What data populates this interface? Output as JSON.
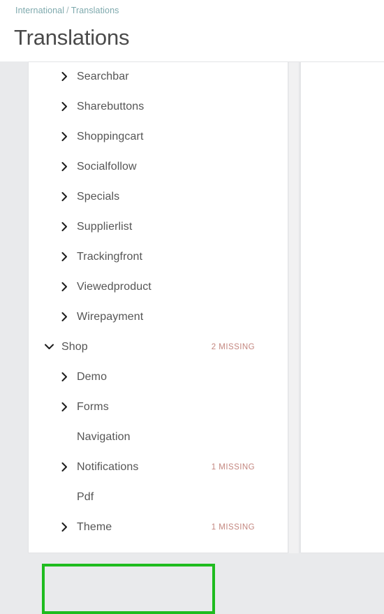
{
  "header": {
    "breadcrumb": {
      "parent": "International",
      "separator": "/",
      "current": "Translations"
    },
    "title": "Translations"
  },
  "colors": {
    "accent_breadcrumb": "#7ea9ad",
    "missing_badge": "#c3867f",
    "highlight_box": "#1fbc1f",
    "row_text": "#555555",
    "page_background": "#e9eaec"
  },
  "tree": {
    "rows": [
      {
        "label": "Searchbar",
        "level": 1,
        "icon": "chevron-right-icon",
        "expanded": false,
        "badge": ""
      },
      {
        "label": "Sharebuttons",
        "level": 1,
        "icon": "chevron-right-icon",
        "expanded": false,
        "badge": ""
      },
      {
        "label": "Shoppingcart",
        "level": 1,
        "icon": "chevron-right-icon",
        "expanded": false,
        "badge": ""
      },
      {
        "label": "Socialfollow",
        "level": 1,
        "icon": "chevron-right-icon",
        "expanded": false,
        "badge": ""
      },
      {
        "label": "Specials",
        "level": 1,
        "icon": "chevron-right-icon",
        "expanded": false,
        "badge": ""
      },
      {
        "label": "Supplierlist",
        "level": 1,
        "icon": "chevron-right-icon",
        "expanded": false,
        "badge": ""
      },
      {
        "label": "Trackingfront",
        "level": 1,
        "icon": "chevron-right-icon",
        "expanded": false,
        "badge": ""
      },
      {
        "label": "Viewedproduct",
        "level": 1,
        "icon": "chevron-right-icon",
        "expanded": false,
        "badge": ""
      },
      {
        "label": "Wirepayment",
        "level": 1,
        "icon": "chevron-right-icon",
        "expanded": false,
        "badge": ""
      },
      {
        "label": "Shop",
        "level": 0,
        "icon": "chevron-down-icon",
        "expanded": true,
        "badge": "2 MISSING"
      },
      {
        "label": "Demo",
        "level": 1,
        "icon": "chevron-right-icon",
        "expanded": false,
        "badge": ""
      },
      {
        "label": "Forms",
        "level": 1,
        "icon": "chevron-right-icon",
        "expanded": false,
        "badge": ""
      },
      {
        "label": "Navigation",
        "level": 1,
        "icon": "none",
        "expanded": false,
        "badge": ""
      },
      {
        "label": "Notifications",
        "level": 1,
        "icon": "chevron-right-icon",
        "expanded": false,
        "badge": "1 MISSING"
      },
      {
        "label": "Pdf",
        "level": 1,
        "icon": "none",
        "expanded": false,
        "badge": ""
      },
      {
        "label": "Theme",
        "level": 1,
        "icon": "chevron-right-icon",
        "expanded": false,
        "badge": "1 MISSING"
      }
    ]
  }
}
